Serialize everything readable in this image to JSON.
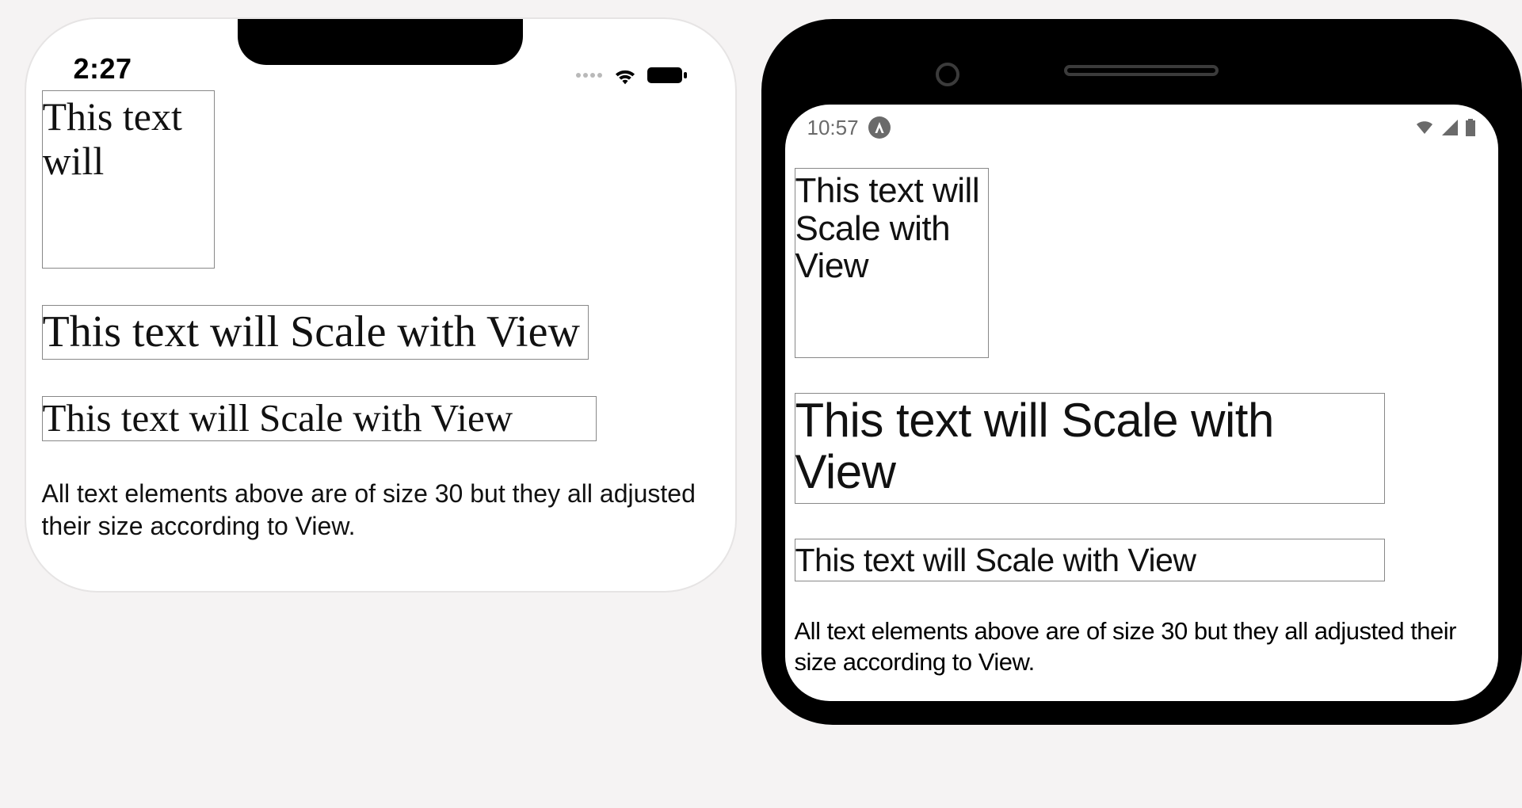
{
  "ios": {
    "time": "2:27",
    "box1_text": "This text will",
    "box2_text": "This text will Scale with View",
    "box3_text": "This text will Scale with View",
    "caption": "All text elements above are of size 30 but they all adjusted their size according to View."
  },
  "android": {
    "time": "10:57",
    "box1_text": "This text will Scale with View",
    "box2_text": "This text will Scale with View",
    "box3_text": "This text will Scale with View",
    "caption": "All text elements above are of size 30 but they all adjusted their size according to View."
  }
}
